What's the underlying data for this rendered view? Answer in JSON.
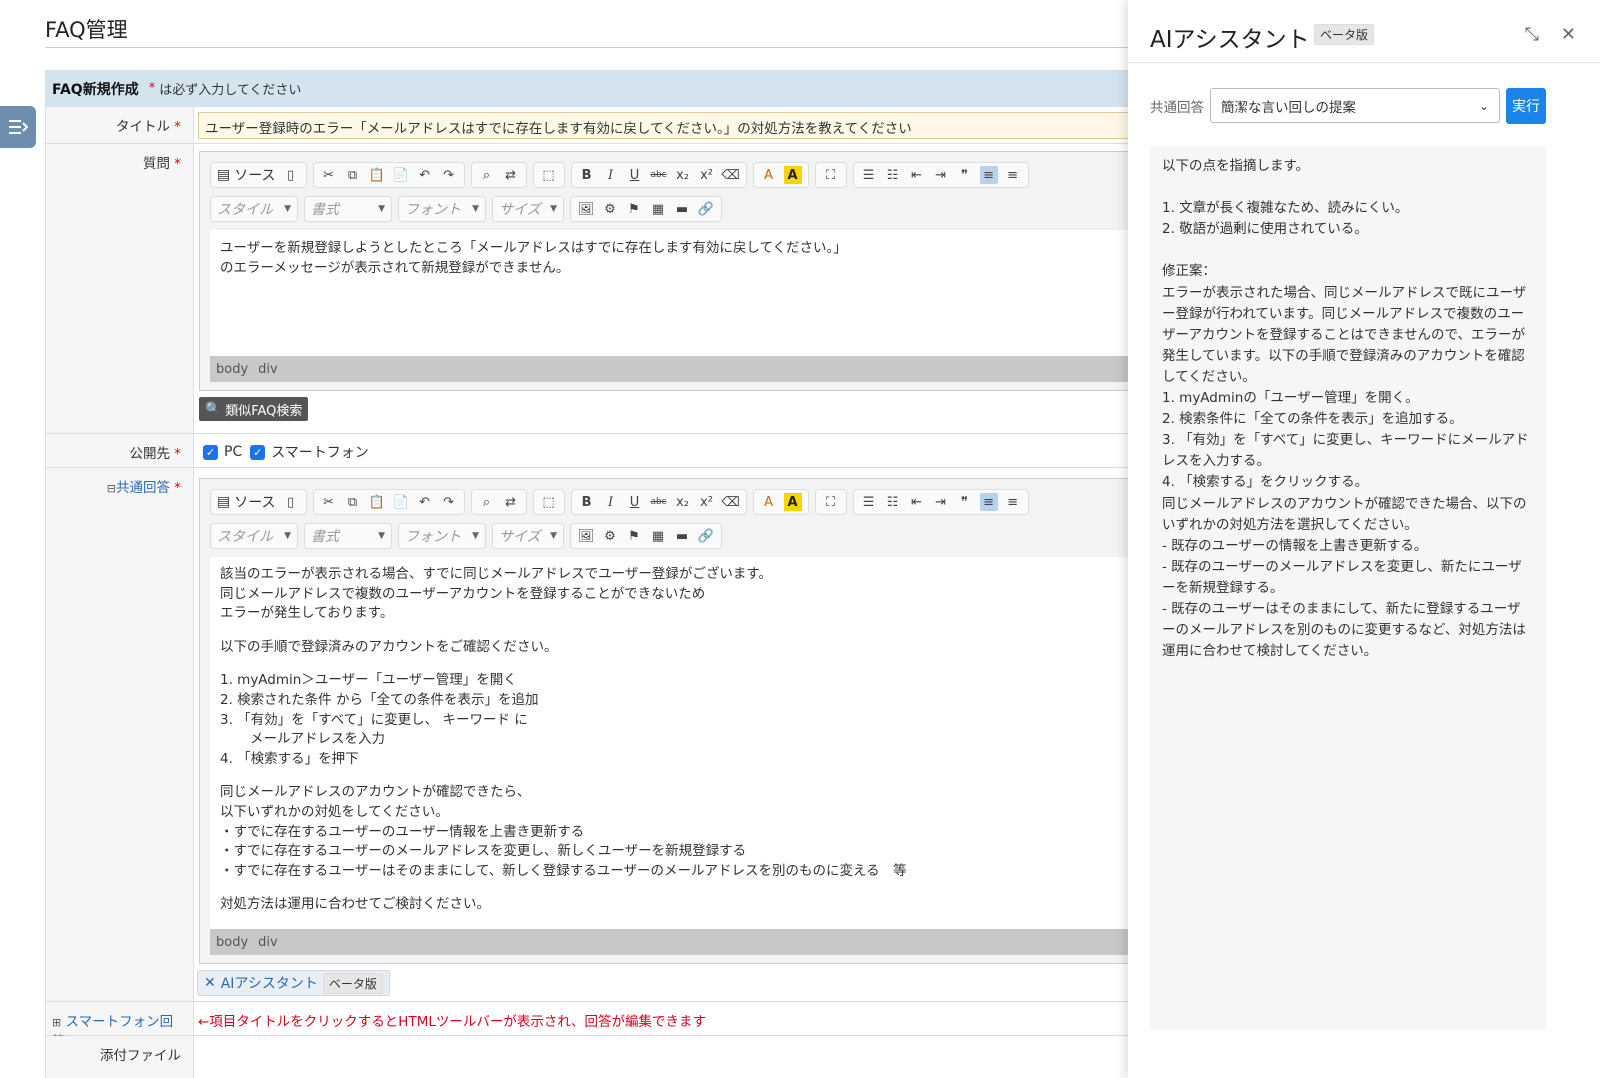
{
  "page": {
    "title": "FAQ管理"
  },
  "form": {
    "header": "FAQ新規作成",
    "required_mark": "*",
    "required_note": "は必ず入力してください",
    "title_label": "タイトル",
    "title_value": "ユーザー登録時のエラー「メールアドレスはすでに存在します有効に戻してください。」の対処方法を教えてください",
    "question_label": "質問",
    "publish_label": "公開先",
    "publish_options": [
      "PC",
      "スマートフォン"
    ],
    "common_answer_label": "共通回答",
    "smartphone_answer_label": "スマートフォン回答",
    "smartphone_hint": "←項目タイトルをクリックするとHTMLツールバーが表示され、回答が編集できます",
    "attachment_label": "添付ファイル",
    "similar_faq_button": "類似FAQ検索",
    "ai_button": "AIアシスタント",
    "ai_beta": "ベータ版"
  },
  "editor": {
    "source_label": "ソース",
    "style_placeholder": "スタイル",
    "format_placeholder": "書式",
    "font_placeholder": "フォント",
    "size_placeholder": "サイズ",
    "path_body": "body",
    "path_div": "div"
  },
  "question_text": [
    "ユーザーを新規登録しようとしたところ「メールアドレスはすでに存在します有効に戻してください。」",
    "のエラーメッセージが表示されて新規登録ができません。"
  ],
  "answer_text": [
    "該当のエラーが表示される場合、すでに同じメールアドレスでユーザー登録がございます。",
    "同じメールアドレスで複数のユーザーアカウントを登録することができないため",
    "エラーが発生しております。",
    "",
    "以下の手順で登録済みのアカウントをご確認ください。",
    "",
    "1.  myAdmin＞ユーザー「ユーザー管理」を開く",
    "2.   検索された条件 から「全ての条件を表示」を追加",
    "3.  「有効」を「すべて」に変更し、 キーワード に",
    "       メールアドレスを入力",
    "4.  「検索する」を押下",
    "",
    "同じメールアドレスのアカウントが確認できたら、",
    "以下いずれかの対処をしてください。",
    "・すでに存在するユーザーのユーザー情報を上書き更新する",
    "・すでに存在するユーザーのメールアドレスを変更し、新しくユーザーを新規登録する",
    "・すでに存在するユーザーはそのままにして、新しく登録するユーザーのメールアドレスを別のものに変える　等",
    "",
    "対処方法は運用に合わせてご検討ください。"
  ],
  "ai_panel": {
    "title": "AIアシスタント",
    "beta": "ベータ版",
    "select_label": "共通回答",
    "select_value": "簡潔な言い回しの提案",
    "run_button": "実行",
    "output": "以下の点を指摘します。\n\n1. 文章が長く複雑なため、読みにくい。\n2. 敬語が過剰に使用されている。\n\n修正案：\nエラーが表示された場合、同じメールアドレスで既にユーザー登録が行われています。同じメールアドレスで複数のユーザーアカウントを登録することはできませんので、エラーが発生しています。以下の手順で登録済みのアカウントを確認してください。\n1. myAdminの「ユーザー管理」を開く。\n2. 検索条件に「全ての条件を表示」を追加する。\n3. 「有効」を「すべて」に変更し、キーワードにメールアドレスを入力する。\n4. 「検索する」をクリックする。\n同じメールアドレスのアカウントが確認できた場合、以下のいずれかの対処方法を選択してください。\n- 既存のユーザーの情報を上書き更新する。\n- 既存のユーザーのメールアドレスを変更し、新たにユーザーを新規登録する。\n- 既存のユーザーはそのままにして、新たに登録するユーザーのメールアドレスを別のものに変更するなど、対処方法は運用に合わせて検討してください。"
  },
  "colors": {
    "accent": "#1a84e8",
    "required": "#d9001b",
    "header_bg": "#d4e4ef"
  }
}
